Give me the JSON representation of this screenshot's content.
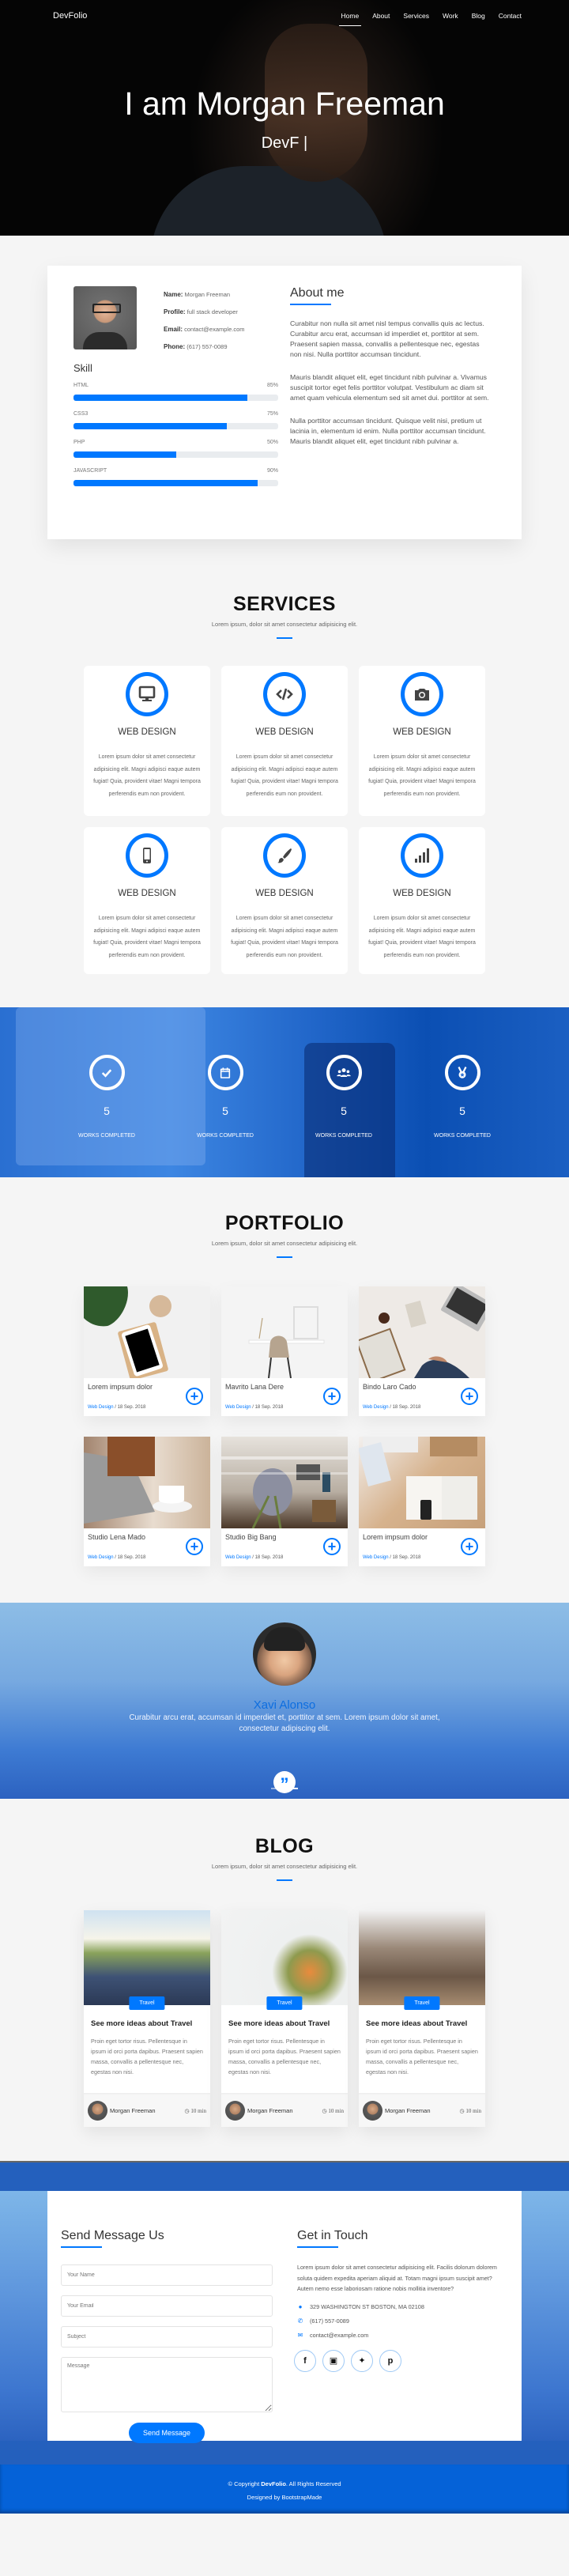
{
  "nav": {
    "brand": "DevFolio",
    "items": [
      "Home",
      "About",
      "Services",
      "Work",
      "Blog",
      "Contact"
    ],
    "active": "Home"
  },
  "hero": {
    "title": "I am Morgan Freeman",
    "subtitle": "DevF |"
  },
  "about": {
    "info": [
      {
        "label": "Name:",
        "value": "Morgan Freeman"
      },
      {
        "label": "Profile:",
        "value": "full stack developer"
      },
      {
        "label": "Email:",
        "value": "contact@example.com"
      },
      {
        "label": "Phone:",
        "value": "(617) 557-0089"
      }
    ],
    "skill_title": "Skill",
    "skills": [
      {
        "name": "HTML",
        "percent_label": "85%",
        "percent": 85
      },
      {
        "name": "CSS3",
        "percent_label": "75%",
        "percent": 75
      },
      {
        "name": "PHP",
        "percent_label": "50%",
        "percent": 50
      },
      {
        "name": "JAVASCRIPT",
        "percent_label": "90%",
        "percent": 90
      }
    ],
    "heading": "About me",
    "paragraphs": [
      "Curabitur non nulla sit amet nisl tempus convallis quis ac lectus. Curabitur arcu erat, accumsan id imperdiet et, porttitor at sem. Praesent sapien massa, convallis a pellentesque nec, egestas non nisi. Nulla porttitor accumsan tincidunt.",
      "Mauris blandit aliquet elit, eget tincidunt nibh pulvinar a. Vivamus suscipit tortor eget felis porttitor volutpat. Vestibulum ac diam sit amet quam vehicula elementum sed sit amet dui. porttitor at sem.",
      "Nulla porttitor accumsan tincidunt. Quisque velit nisi, pretium ut lacinia in, elementum id enim. Nulla porttitor accumsan tincidunt. Mauris blandit aliquet elit, eget tincidunt nibh pulvinar a."
    ]
  },
  "services": {
    "title": "SERVICES",
    "subtitle": "Lorem ipsum, dolor sit amet consectetur adipisicing elit.",
    "items": [
      {
        "icon": "monitor-icon",
        "title": "WEB DESIGN",
        "text": "Lorem ipsum dolor sit amet consectetur adipisicing elit. Magni adipisci eaque autem fugiat! Quia, provident vitae! Magni tempora perferendis eum non provident."
      },
      {
        "icon": "code-icon",
        "title": "WEB DESIGN",
        "text": "Lorem ipsum dolor sit amet consectetur adipisicing elit. Magni adipisci eaque autem fugiat! Quia, provident vitae! Magni tempora perferendis eum non provident."
      },
      {
        "icon": "camera-icon",
        "title": "WEB DESIGN",
        "text": "Lorem ipsum dolor sit amet consectetur adipisicing elit. Magni adipisci eaque autem fugiat! Quia, provident vitae! Magni tempora perferendis eum non provident."
      },
      {
        "icon": "mobile-icon",
        "title": "WEB DESIGN",
        "text": "Lorem ipsum dolor sit amet consectetur adipisicing elit. Magni adipisci eaque autem fugiat! Quia, provident vitae! Magni tempora perferendis eum non provident."
      },
      {
        "icon": "paintbrush-icon",
        "title": "WEB DESIGN",
        "text": "Lorem ipsum dolor sit amet consectetur adipisicing elit. Magni adipisci eaque autem fugiat! Quia, provident vitae! Magni tempora perferendis eum non provident."
      },
      {
        "icon": "signal-bars-icon",
        "title": "WEB DESIGN",
        "text": "Lorem ipsum dolor sit amet consectetur adipisicing elit. Magni adipisci eaque autem fugiat! Quia, provident vitae! Magni tempora perferendis eum non provident."
      }
    ]
  },
  "counters": [
    {
      "icon": "checkmark-icon",
      "value": "5",
      "label": "WORKS COMPLETED"
    },
    {
      "icon": "calendar-icon",
      "value": "5",
      "label": "WORKS COMPLETED"
    },
    {
      "icon": "users-icon",
      "value": "5",
      "label": "WORKS COMPLETED"
    },
    {
      "icon": "medal-icon",
      "value": "5",
      "label": "WORKS COMPLETED"
    }
  ],
  "portfolio": {
    "title": "PORTFOLIO",
    "subtitle": "Lorem ipsum, dolor sit amet consectetur adipisicing elit.",
    "items": [
      {
        "title": "Lorem impsum dolor",
        "category": "Web Design",
        "date": " / 18 Sep. 2018"
      },
      {
        "title": "Mavrito Lana Dere",
        "category": "Web Design",
        "date": " / 18 Sep. 2018"
      },
      {
        "title": "Bindo Laro Cado",
        "category": "Web Design",
        "date": " / 18 Sep. 2018"
      },
      {
        "title": "Studio Lena Mado",
        "category": "Web Design",
        "date": " / 18 Sep. 2018"
      },
      {
        "title": "Studio Big Bang",
        "category": "Web Design",
        "date": " / 18 Sep. 2018"
      },
      {
        "title": "Lorem impsum dolor",
        "category": "Web Design",
        "date": " / 18 Sep. 2018"
      }
    ]
  },
  "testimonial": {
    "name": "Xavi Alonso",
    "quote": "Curabitur arcu erat, accumsan id imperdiet et, porttitor at sem. Lorem ipsum dolor sit amet, consectetur adipiscing elit.",
    "quote_glyph": "”",
    "slides": 2,
    "active_slide": 2
  },
  "blog": {
    "title": "BLOG",
    "subtitle": "Lorem ipsum, dolor sit amet consectetur adipisicing elit.",
    "posts": [
      {
        "tag": "Travel",
        "title": "See more ideas about Travel",
        "excerpt": "Proin eget tortor risus. Pellentesque in ipsum id orci porta dapibus. Praesent sapien massa, convallis a pellentesque nec, egestas non nisi.",
        "author": "Morgan Freeman",
        "time": "10 min"
      },
      {
        "tag": "Travel",
        "title": "See more ideas about Travel",
        "excerpt": "Proin eget tortor risus. Pellentesque in ipsum id orci porta dapibus. Praesent sapien massa, convallis a pellentesque nec, egestas non nisi.",
        "author": "Morgan Freeman",
        "time": "10 min"
      },
      {
        "tag": "Travel",
        "title": "See more ideas about Travel",
        "excerpt": "Proin eget tortor risus. Pellentesque in ipsum id orci porta dapibus. Praesent sapien massa, convallis a pellentesque nec, egestas non nisi.",
        "author": "Morgan Freeman",
        "time": "10 min"
      }
    ]
  },
  "contact": {
    "form_title": "Send Message Us",
    "placeholders": {
      "name": "Your Name",
      "email": "Your Email",
      "subject": "Subject",
      "message": "Message"
    },
    "submit": "Send Message",
    "info_title": "Get in Touch",
    "info_text": "Lorem ipsum dolor sit amet consectetur adipisicing elit. Facilis dolorum dolorem soluta quidem expedita aperiam aliquid at. Totam magni ipsum suscipit amet? Autem nemo esse laboriosam ratione nobis mollitia inventore?",
    "address": "329 WASHINGTON ST BOSTON, MA 02108",
    "phone": "(617) 557-0089",
    "email": "contact@example.com",
    "socials": [
      "facebook",
      "instagram",
      "twitter",
      "pinterest"
    ]
  },
  "footer": {
    "copyright_prefix": "© Copyright ",
    "copyright_brand": "DevFolio",
    "copyright_suffix": ". All Rights Reserved",
    "designed_by": "Designed by BootstrapMade"
  },
  "colors": {
    "accent": "#0078ff",
    "footer_bg": "#0562d8"
  }
}
